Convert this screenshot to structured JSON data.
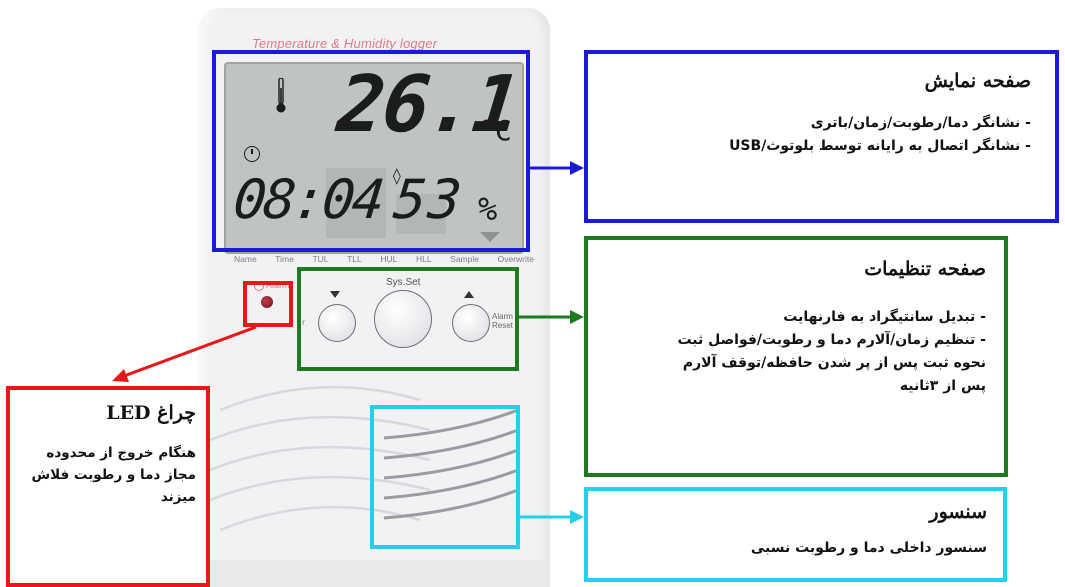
{
  "device": {
    "brand": "Temperature & Humidity logger",
    "temperature": "26.1",
    "temperature_unit": "°C",
    "time": "08:04",
    "humidity": "53",
    "humidity_unit": "%",
    "bottom_labels": [
      "Name",
      "Time",
      "TUL",
      "TLL",
      "HUL",
      "HLL",
      "Sample",
      "Overwrite"
    ],
    "alarm_label": "Alarm",
    "sysset_label": "Sys.Set",
    "alarm_reset_label": [
      "Alarm",
      "Reset"
    ]
  },
  "callouts": {
    "display": {
      "title": "صفحه نمایش",
      "lines": [
        "- نشانگر دما/رطوبت/زمان/باتری",
        "- نشانگر اتصال به رایانه توسط بلوتوث/USB"
      ]
    },
    "settings": {
      "title": "صفحه تنظیمات",
      "lines": [
        "- تبدیل سانتیگراد به فارنهایت",
        "- تنظیم زمان/آلارم دما و رطوبت/فواصل ثبت",
        "نحوه ثبت پس از پر شدن حافظه/توقف آلارم",
        "پس از ۳ثانیه"
      ]
    },
    "led": {
      "title": "چراغ LED",
      "text": "هنگام خروج از محدوده مجاز دما و رطوبت فلاش میزند"
    },
    "sensor": {
      "title": "سنسور",
      "text": "سنسور داخلی دما و رطوبت نسبی"
    }
  },
  "colors": {
    "display": "#1a1adb",
    "settings": "#1e7a1e",
    "led": "#e81818",
    "sensor": "#22cfee"
  }
}
